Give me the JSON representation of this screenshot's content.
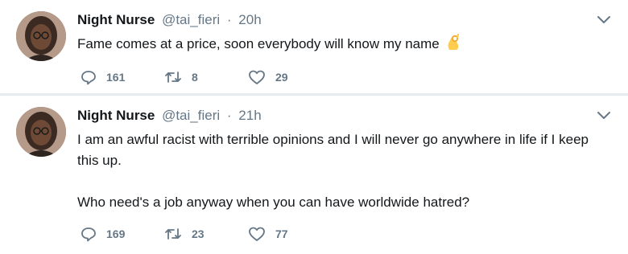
{
  "tweets": [
    {
      "author": {
        "display_name": "Night Nurse",
        "handle": "@tai_fieri",
        "avatar_icon": "profile-photo"
      },
      "separator": "·",
      "timestamp": "20h",
      "paragraphs": [
        "Fame comes at a price, soon everybody will know my name"
      ],
      "emoji": "ok-hand-emoji",
      "stats": {
        "replies": "161",
        "retweets": "8",
        "likes": "29"
      }
    },
    {
      "author": {
        "display_name": "Night Nurse",
        "handle": "@tai_fieri",
        "avatar_icon": "profile-photo"
      },
      "separator": "·",
      "timestamp": "21h",
      "paragraphs": [
        "I am an awful racist with terrible opinions and I will never go anywhere in life if I keep this up.",
        "Who need's a job anyway when you can have worldwide hatred?"
      ],
      "stats": {
        "replies": "169",
        "retweets": "23",
        "likes": "77"
      }
    }
  ],
  "icons": {
    "reply": "reply-icon",
    "retweet": "retweet-icon",
    "like": "heart-icon",
    "menu": "chevron-down-icon"
  },
  "colors": {
    "muted": "#657786",
    "text": "#14171a",
    "separator": "#e6ecf0"
  }
}
